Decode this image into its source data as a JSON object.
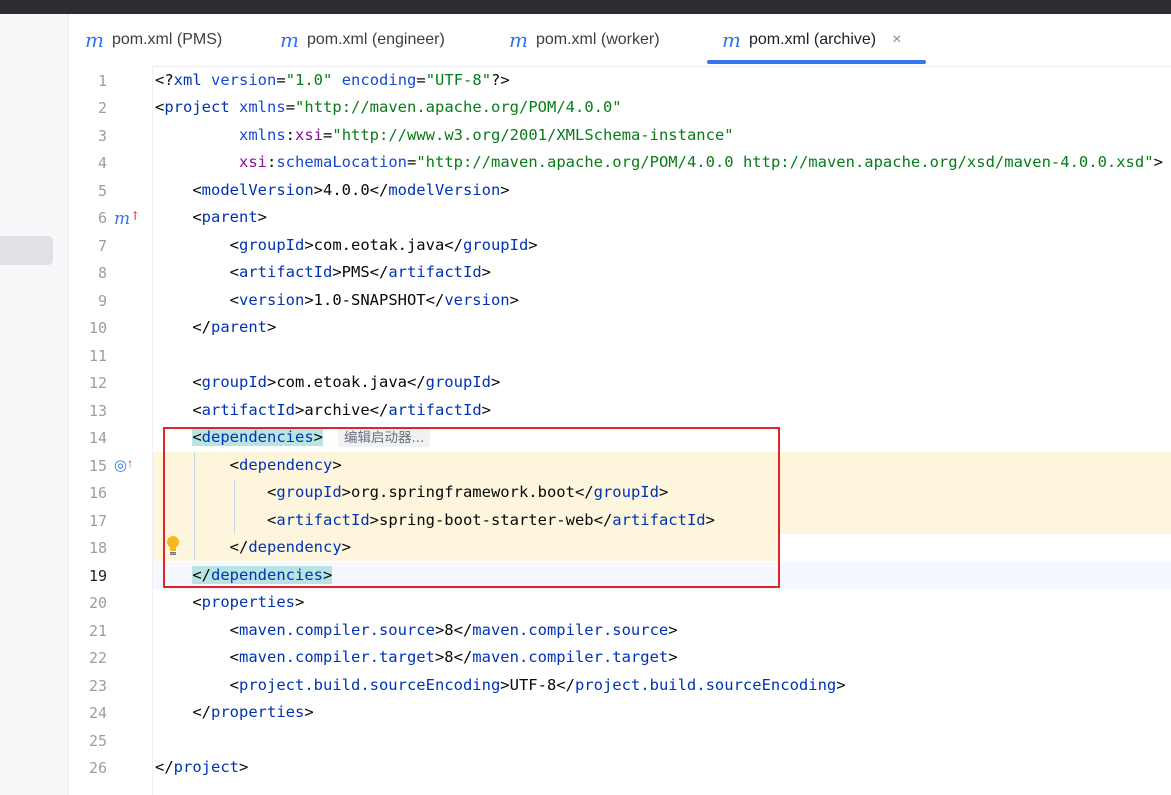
{
  "tabs": [
    {
      "icon": "maven-icon",
      "label": "pom.xml (PMS)"
    },
    {
      "icon": "maven-icon",
      "label": "pom.xml (engineer)"
    },
    {
      "icon": "maven-icon",
      "label": "pom.xml (worker)"
    },
    {
      "icon": "maven-icon",
      "label": "pom.xml (archive)",
      "active": true,
      "close": "×"
    }
  ],
  "tab_icon_glyph": "m",
  "gutter": {
    "line_numbers": [
      "1",
      "2",
      "3",
      "4",
      "5",
      "6",
      "7",
      "8",
      "9",
      "10",
      "11",
      "12",
      "13",
      "14",
      "15",
      "16",
      "17",
      "18",
      "19",
      "20",
      "21",
      "22",
      "23",
      "24",
      "25",
      "26"
    ],
    "current_line": "19",
    "marker_6": "m",
    "marker_15": "◎",
    "arrow": "↑"
  },
  "inlay_hint": "编辑启动器...",
  "code": {
    "l1": [
      "<?",
      "xml",
      " ",
      "version",
      "=",
      "\"1.0\"",
      " ",
      "encoding",
      "=",
      "\"UTF-8\"",
      "?>"
    ],
    "l2": [
      "<",
      "project",
      " ",
      "xmlns",
      "=",
      "\"http://maven.apache.org/POM/4.0.0\""
    ],
    "l3": [
      "         ",
      "xmlns",
      ":",
      "xsi",
      "=",
      "\"http://www.w3.org/2001/XMLSchema-instance\""
    ],
    "l4": [
      "         ",
      "xsi",
      ":",
      "schemaLocation",
      "=",
      "\"http://maven.apache.org/POM/4.0.0 http://maven.apache.org/xsd/maven-4.0.0.xsd\"",
      ">"
    ],
    "l5": [
      "    <",
      "modelVersion",
      ">4.0.0</",
      "modelVersion",
      ">"
    ],
    "l6": [
      "    <",
      "parent",
      ">"
    ],
    "l7": [
      "        <",
      "groupId",
      ">com.eotak.java</",
      "groupId",
      ">"
    ],
    "l8": [
      "        <",
      "artifactId",
      ">PMS</",
      "artifactId",
      ">"
    ],
    "l9": [
      "        <",
      "version",
      ">1.0-SNAPSHOT</",
      "version",
      ">"
    ],
    "l10": [
      "    </",
      "parent",
      ">"
    ],
    "l12": [
      "    <",
      "groupId",
      ">com.etoak.java</",
      "groupId",
      ">"
    ],
    "l13": [
      "    <",
      "artifactId",
      ">archive</",
      "artifactId",
      ">"
    ],
    "l14": [
      "    ",
      "<",
      "dependencies",
      ">"
    ],
    "l15": [
      "        <",
      "dependency",
      ">"
    ],
    "l16": [
      "            <",
      "groupId",
      ">org.springframework.boot</",
      "groupId",
      ">"
    ],
    "l17": [
      "            <",
      "artifactId",
      ">spring-boot-starter-web</",
      "artifactId",
      ">"
    ],
    "l18": [
      "        </",
      "dependency",
      ">"
    ],
    "l19": [
      "    ",
      "</",
      "dependencies",
      ">"
    ],
    "l20": [
      "    <",
      "properties",
      ">"
    ],
    "l21": [
      "        <",
      "maven.compiler.source",
      ">8</",
      "maven.compiler.source",
      ">"
    ],
    "l22": [
      "        <",
      "maven.compiler.target",
      ">8</",
      "maven.compiler.target",
      ">"
    ],
    "l23": [
      "        <",
      "project.build.sourceEncoding",
      ">UTF-8</",
      "project.build.sourceEncoding",
      ">"
    ],
    "l24": [
      "    </",
      "properties",
      ">"
    ],
    "l26": [
      "</",
      "project",
      ">"
    ]
  }
}
